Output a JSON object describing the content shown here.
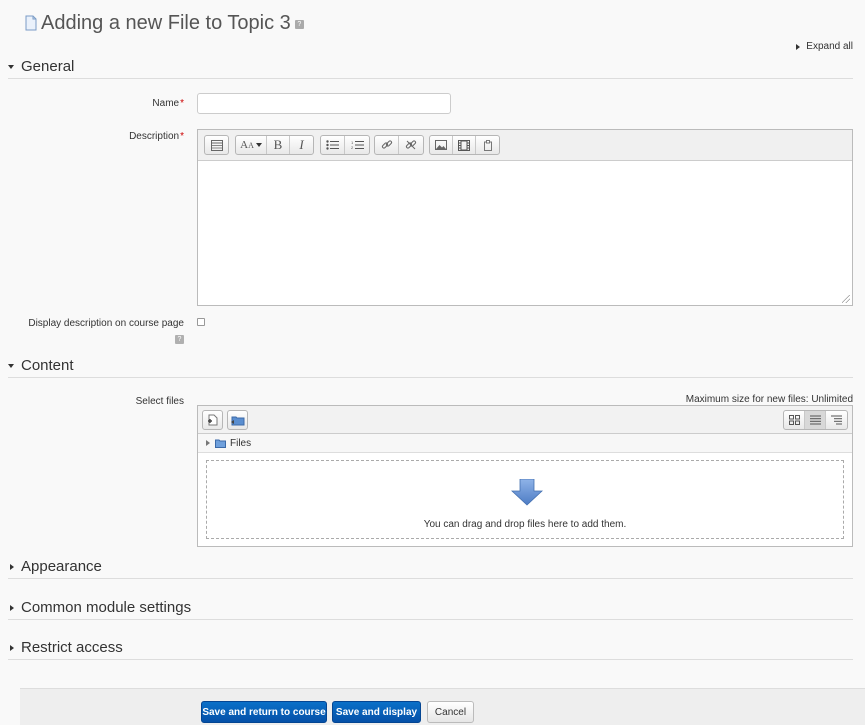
{
  "page": {
    "title": "Adding a new File to Topic 3",
    "expand_all": "Expand all"
  },
  "sections": {
    "general": "General",
    "content": "Content",
    "appearance": "Appearance",
    "common_module": "Common module settings",
    "restrict_access": "Restrict access"
  },
  "form": {
    "name_label": "Name",
    "name_value": "",
    "description_label": "Description",
    "required_marker": "*",
    "display_description_label": "Display description on course page",
    "select_files_label": "Select files",
    "max_size": "Maximum size for new files: Unlimited",
    "files_path": "Files",
    "drop_text": "You can drag and drop files here to add them."
  },
  "toolbar_icons": [
    "toolbar-toggle-icon",
    "font-style-icon",
    "bold-icon",
    "italic-icon",
    "unordered-list-icon",
    "ordered-list-icon",
    "link-icon",
    "unlink-icon",
    "image-icon",
    "media-icon",
    "manage-files-icon"
  ],
  "buttons": {
    "save_return": "Save and return to course",
    "save_display": "Save and display",
    "cancel": "Cancel"
  },
  "colors": {
    "primary": "#0550a8",
    "required": "#c00000",
    "background": "#f9f9f9"
  }
}
